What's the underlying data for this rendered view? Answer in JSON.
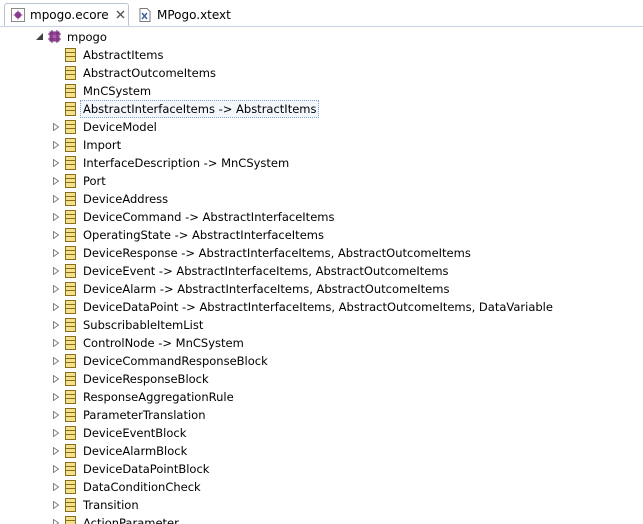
{
  "tabs": [
    {
      "label": "mpogo.ecore",
      "icon": "ecore-model-icon",
      "active": true
    },
    {
      "label": "MPogo.xtext",
      "icon": "xtext-file-icon",
      "active": false
    }
  ],
  "tree": {
    "root": {
      "label": "mpogo",
      "icon": "package-icon",
      "expanded": true
    },
    "items": [
      {
        "label": "AbstractItems",
        "expandable": false
      },
      {
        "label": "AbstractOutcomeItems",
        "expandable": false
      },
      {
        "label": "MnCSystem",
        "expandable": false
      },
      {
        "label": "AbstractInterfaceItems -> AbstractItems",
        "expandable": false,
        "selected": true
      },
      {
        "label": "DeviceModel",
        "expandable": true
      },
      {
        "label": "Import",
        "expandable": true
      },
      {
        "label": "InterfaceDescription -> MnCSystem",
        "expandable": true
      },
      {
        "label": "Port",
        "expandable": true
      },
      {
        "label": "DeviceAddress",
        "expandable": true
      },
      {
        "label": "DeviceCommand -> AbstractInterfaceItems",
        "expandable": true
      },
      {
        "label": "OperatingState -> AbstractInterfaceItems",
        "expandable": true
      },
      {
        "label": "DeviceResponse -> AbstractInterfaceItems, AbstractOutcomeItems",
        "expandable": true
      },
      {
        "label": "DeviceEvent -> AbstractInterfaceItems, AbstractOutcomeItems",
        "expandable": true
      },
      {
        "label": "DeviceAlarm -> AbstractInterfaceItems, AbstractOutcomeItems",
        "expandable": true
      },
      {
        "label": "DeviceDataPoint -> AbstractInterfaceItems, AbstractOutcomeItems, DataVariable",
        "expandable": true
      },
      {
        "label": "SubscribableItemList",
        "expandable": true
      },
      {
        "label": "ControlNode -> MnCSystem",
        "expandable": true
      },
      {
        "label": "DeviceCommandResponseBlock",
        "expandable": true
      },
      {
        "label": "DeviceResponseBlock",
        "expandable": true
      },
      {
        "label": "ResponseAggregationRule",
        "expandable": true
      },
      {
        "label": "ParameterTranslation",
        "expandable": true
      },
      {
        "label": "DeviceEventBlock",
        "expandable": true
      },
      {
        "label": "DeviceAlarmBlock",
        "expandable": true
      },
      {
        "label": "DeviceDataPointBlock",
        "expandable": true
      },
      {
        "label": "DataConditionCheck",
        "expandable": true
      },
      {
        "label": "Transition",
        "expandable": true
      },
      {
        "label": "ActionParameter",
        "expandable": true
      }
    ]
  },
  "colors": {
    "class_icon_fill": "#f2e08a",
    "class_icon_border": "#8a6d1a",
    "package_icon": "#8b3a8f",
    "tab_border": "#b9c5d7",
    "selection_border": "#7da2ce"
  }
}
